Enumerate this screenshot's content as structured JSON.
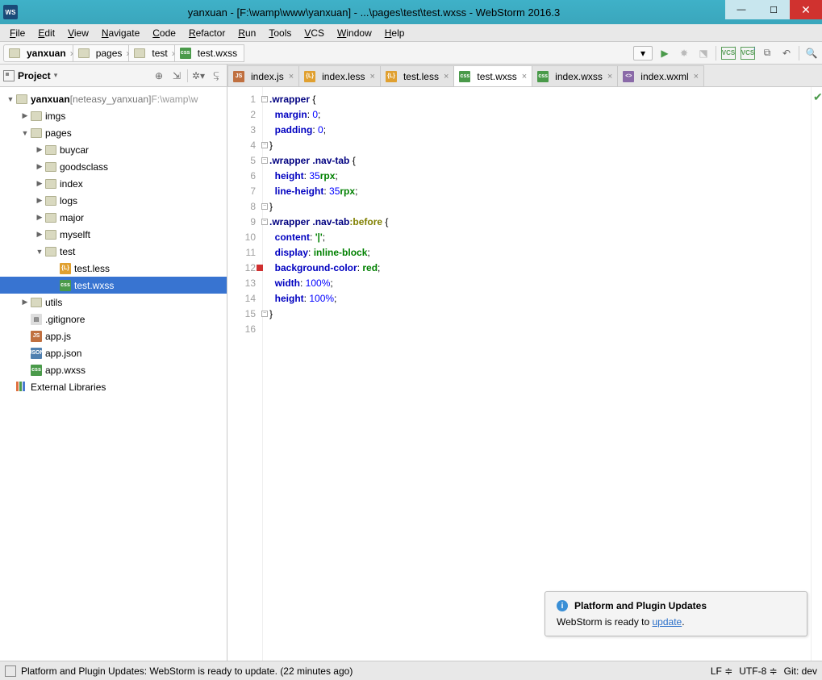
{
  "window": {
    "title": "yanxuan - [F:\\wamp\\www\\yanxuan] - ...\\pages\\test\\test.wxss - WebStorm 2016.3",
    "app_badge": "WS"
  },
  "menu": [
    "File",
    "Edit",
    "View",
    "Navigate",
    "Code",
    "Refactor",
    "Run",
    "Tools",
    "VCS",
    "Window",
    "Help"
  ],
  "breadcrumbs": [
    {
      "label": "yanxuan",
      "icon": "folder"
    },
    {
      "label": "pages",
      "icon": "folder"
    },
    {
      "label": "test",
      "icon": "folder"
    },
    {
      "label": "test.wxss",
      "icon": "css"
    }
  ],
  "project_panel": {
    "title": "Project",
    "root": {
      "label": "yanxuan",
      "qualifier": "[neteasy_yanxuan]",
      "path": "F:\\wamp\\w"
    },
    "tree": [
      {
        "depth": 1,
        "tw": "▶",
        "icon": "folder",
        "label": "imgs"
      },
      {
        "depth": 1,
        "tw": "▼",
        "icon": "folder",
        "label": "pages"
      },
      {
        "depth": 2,
        "tw": "▶",
        "icon": "folder",
        "label": "buycar"
      },
      {
        "depth": 2,
        "tw": "▶",
        "icon": "folder",
        "label": "goodsclass"
      },
      {
        "depth": 2,
        "tw": "▶",
        "icon": "folder",
        "label": "index"
      },
      {
        "depth": 2,
        "tw": "▶",
        "icon": "folder",
        "label": "logs"
      },
      {
        "depth": 2,
        "tw": "▶",
        "icon": "folder",
        "label": "major"
      },
      {
        "depth": 2,
        "tw": "▶",
        "icon": "folder",
        "label": "myselft"
      },
      {
        "depth": 2,
        "tw": "▼",
        "icon": "folder",
        "label": "test"
      },
      {
        "depth": 3,
        "tw": "",
        "icon": "less",
        "label": "test.less"
      },
      {
        "depth": 3,
        "tw": "",
        "icon": "css",
        "label": "test.wxss",
        "selected": true
      },
      {
        "depth": 1,
        "tw": "▶",
        "icon": "folder",
        "label": "utils"
      },
      {
        "depth": 1,
        "tw": "",
        "icon": "file",
        "label": ".gitignore"
      },
      {
        "depth": 1,
        "tw": "",
        "icon": "js",
        "label": "app.js"
      },
      {
        "depth": 1,
        "tw": "",
        "icon": "json",
        "label": "app.json"
      },
      {
        "depth": 1,
        "tw": "",
        "icon": "css",
        "label": "app.wxss"
      }
    ],
    "external": "External Libraries"
  },
  "tabs": [
    {
      "label": "index.js",
      "icon": "js"
    },
    {
      "label": "index.less",
      "icon": "less"
    },
    {
      "label": "test.less",
      "icon": "less"
    },
    {
      "label": "test.wxss",
      "icon": "css",
      "active": true
    },
    {
      "label": "index.wxss",
      "icon": "css"
    },
    {
      "label": "index.wxml",
      "icon": "xml"
    }
  ],
  "editor": {
    "lines": [
      1,
      2,
      3,
      4,
      5,
      6,
      7,
      8,
      9,
      10,
      11,
      12,
      13,
      14,
      15,
      16
    ],
    "highlight_line": 8,
    "breakpoint_line": 12,
    "code": [
      {
        "t": [
          {
            "c": "sel-css",
            "s": ".wrapper"
          },
          {
            "c": "",
            "s": " {"
          }
        ],
        "fold": true
      },
      {
        "t": [
          {
            "c": "",
            "s": "  "
          },
          {
            "c": "prop",
            "s": "margin"
          },
          {
            "c": "",
            "s": ": "
          },
          {
            "c": "num",
            "s": "0"
          },
          {
            "c": "",
            "s": ";"
          }
        ]
      },
      {
        "t": [
          {
            "c": "",
            "s": "  "
          },
          {
            "c": "prop",
            "s": "padding"
          },
          {
            "c": "",
            "s": ": "
          },
          {
            "c": "num",
            "s": "0"
          },
          {
            "c": "",
            "s": ";"
          }
        ]
      },
      {
        "t": [
          {
            "c": "",
            "s": "}"
          }
        ],
        "foldend": true
      },
      {
        "t": [
          {
            "c": "sel-css",
            "s": ".wrapper"
          },
          {
            "c": "",
            "s": " "
          },
          {
            "c": "sel-css",
            "s": ".nav-tab"
          },
          {
            "c": "",
            "s": " {"
          }
        ],
        "fold": true
      },
      {
        "t": [
          {
            "c": "",
            "s": "  "
          },
          {
            "c": "prop",
            "s": "height"
          },
          {
            "c": "",
            "s": ": "
          },
          {
            "c": "num",
            "s": "35"
          },
          {
            "c": "val",
            "s": "rpx"
          },
          {
            "c": "",
            "s": ";"
          }
        ]
      },
      {
        "t": [
          {
            "c": "",
            "s": "  "
          },
          {
            "c": "prop",
            "s": "line-height"
          },
          {
            "c": "",
            "s": ": "
          },
          {
            "c": "num",
            "s": "35"
          },
          {
            "c": "val",
            "s": "rpx"
          },
          {
            "c": "",
            "s": ";"
          }
        ]
      },
      {
        "t": [
          {
            "c": "",
            "s": "}"
          }
        ],
        "foldend": true
      },
      {
        "t": [
          {
            "c": "sel-css",
            "s": ".wrapper"
          },
          {
            "c": "",
            "s": " "
          },
          {
            "c": "sel-css",
            "s": ".nav-tab"
          },
          {
            "c": "pseudo",
            "s": ":before"
          },
          {
            "c": "",
            "s": " {"
          }
        ],
        "fold": true
      },
      {
        "t": [
          {
            "c": "",
            "s": "  "
          },
          {
            "c": "prop",
            "s": "content"
          },
          {
            "c": "",
            "s": ": "
          },
          {
            "c": "str",
            "s": "'|'"
          },
          {
            "c": "",
            "s": ";"
          }
        ]
      },
      {
        "t": [
          {
            "c": "",
            "s": "  "
          },
          {
            "c": "prop",
            "s": "display"
          },
          {
            "c": "",
            "s": ": "
          },
          {
            "c": "val",
            "s": "inline-block"
          },
          {
            "c": "",
            "s": ";"
          }
        ]
      },
      {
        "t": [
          {
            "c": "",
            "s": "  "
          },
          {
            "c": "prop",
            "s": "background-color"
          },
          {
            "c": "",
            "s": ": "
          },
          {
            "c": "val",
            "s": "red"
          },
          {
            "c": "",
            "s": ";"
          }
        ]
      },
      {
        "t": [
          {
            "c": "",
            "s": "  "
          },
          {
            "c": "prop",
            "s": "width"
          },
          {
            "c": "",
            "s": ": "
          },
          {
            "c": "num",
            "s": "100%"
          },
          {
            "c": "",
            "s": ";"
          }
        ]
      },
      {
        "t": [
          {
            "c": "",
            "s": "  "
          },
          {
            "c": "prop",
            "s": "height"
          },
          {
            "c": "",
            "s": ": "
          },
          {
            "c": "num",
            "s": "100%"
          },
          {
            "c": "",
            "s": ";"
          }
        ]
      },
      {
        "t": [
          {
            "c": "",
            "s": "}"
          }
        ],
        "foldend": true
      },
      {
        "t": []
      }
    ]
  },
  "notification": {
    "title": "Platform and Plugin Updates",
    "body_pre": "WebStorm is ready to ",
    "body_link": "update",
    "body_post": "."
  },
  "statusbar": {
    "msg": "Platform and Plugin Updates: WebStorm is ready to update. (22 minutes ago)",
    "lf": "LF",
    "enc": "UTF-8",
    "git": "Git: dev"
  }
}
